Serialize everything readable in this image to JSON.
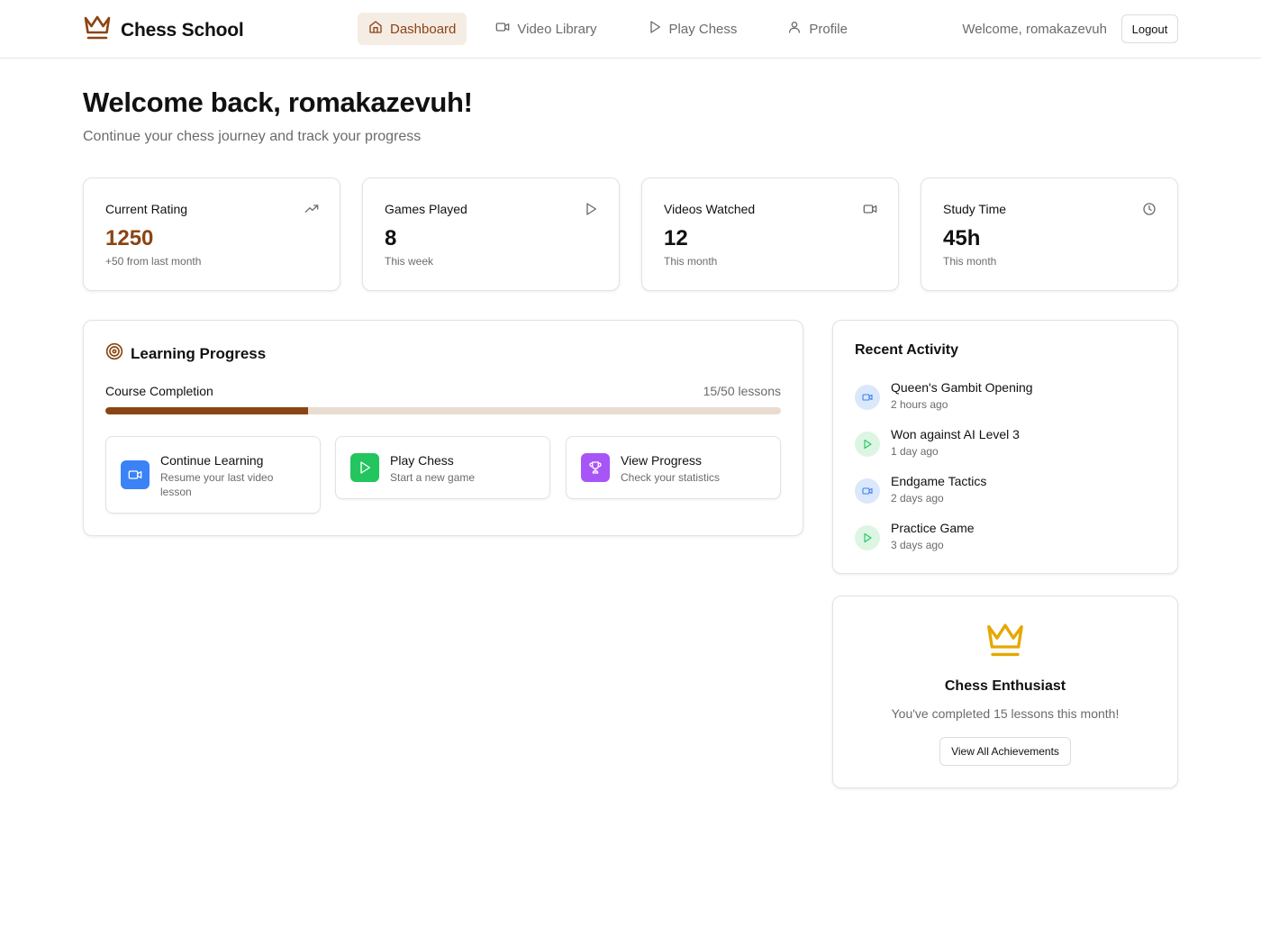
{
  "header": {
    "brand": "Chess School",
    "nav": [
      {
        "label": "Dashboard",
        "icon": "home-icon",
        "active": true
      },
      {
        "label": "Video Library",
        "icon": "video-icon",
        "active": false
      },
      {
        "label": "Play Chess",
        "icon": "play-icon",
        "active": false
      },
      {
        "label": "Profile",
        "icon": "user-icon",
        "active": false
      }
    ],
    "welcome": "Welcome, romakazevuh",
    "logout_label": "Logout"
  },
  "hero": {
    "title": "Welcome back, romakazevuh!",
    "subtitle": "Continue your chess journey and track your progress"
  },
  "stats": [
    {
      "label": "Current Rating",
      "value": "1250",
      "note": "+50 from last month",
      "icon": "trending-up-icon"
    },
    {
      "label": "Games Played",
      "value": "8",
      "note": "This week",
      "icon": "play-icon"
    },
    {
      "label": "Videos Watched",
      "value": "12",
      "note": "This month",
      "icon": "video-icon"
    },
    {
      "label": "Study Time",
      "value": "45h",
      "note": "This month",
      "icon": "clock-icon"
    }
  ],
  "learning_progress": {
    "title": "Learning Progress",
    "course_label": "Course Completion",
    "course_count": "15/50 lessons",
    "completed": 15,
    "total": 50,
    "actions": [
      {
        "title": "Continue Learning",
        "subtitle": "Resume your last video lesson",
        "icon": "video-icon",
        "color": "#3b82f6"
      },
      {
        "title": "Play Chess",
        "subtitle": "Start a new game",
        "icon": "play-icon",
        "color": "#22c55e"
      },
      {
        "title": "View Progress",
        "subtitle": "Check your statistics",
        "icon": "trophy-icon",
        "color": "#a855f7"
      }
    ]
  },
  "recent_activity": {
    "title": "Recent Activity",
    "items": [
      {
        "name": "Queen's Gambit Opening",
        "time": "2 hours ago",
        "type": "video"
      },
      {
        "name": "Won against AI Level 3",
        "time": "1 day ago",
        "type": "play"
      },
      {
        "name": "Endgame Tactics",
        "time": "2 days ago",
        "type": "video"
      },
      {
        "name": "Practice Game",
        "time": "3 days ago",
        "type": "play"
      }
    ]
  },
  "achievement": {
    "title": "Chess Enthusiast",
    "subtitle": "You've completed 15 lessons this month!",
    "button_label": "View All Achievements"
  },
  "colors": {
    "brand": "#8b4513",
    "active_nav_bg": "#f5ece4",
    "progress_track": "#eadcd1",
    "gold": "#e6a700"
  }
}
